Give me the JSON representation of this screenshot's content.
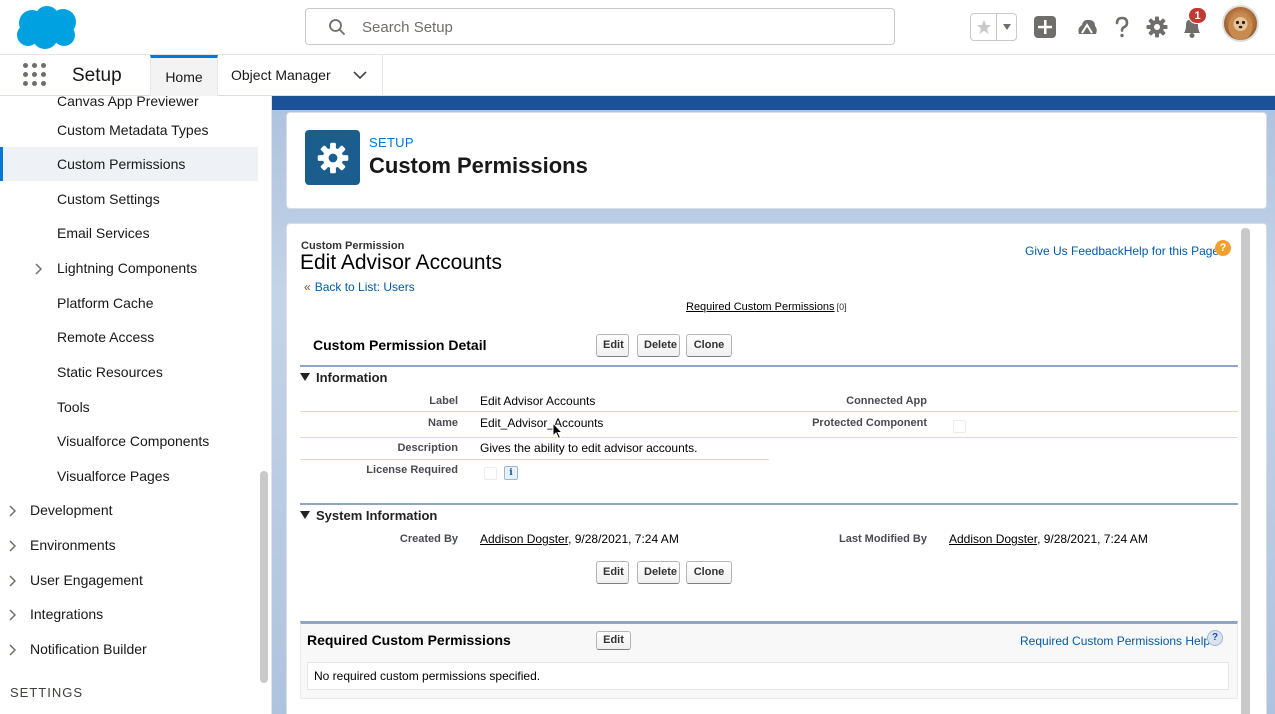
{
  "header": {
    "search_placeholder": "Search Setup",
    "notification_count": "1",
    "brand_color": "#00a1e0"
  },
  "nav": {
    "app_name": "Setup",
    "tabs": [
      {
        "label": "Home",
        "active": true
      },
      {
        "label": "Object Manager",
        "active": false
      }
    ]
  },
  "sidebar": {
    "items": [
      {
        "label": "Canvas App Previewer"
      },
      {
        "label": "Custom Metadata Types"
      },
      {
        "label": "Custom Permissions",
        "active": true
      },
      {
        "label": "Custom Settings"
      },
      {
        "label": "Email Services"
      },
      {
        "label": "Lightning Components"
      },
      {
        "label": "Platform Cache"
      },
      {
        "label": "Remote Access"
      },
      {
        "label": "Static Resources"
      },
      {
        "label": "Tools"
      },
      {
        "label": "Visualforce Components"
      },
      {
        "label": "Visualforce Pages"
      },
      {
        "label": "Development"
      },
      {
        "label": "Environments"
      },
      {
        "label": "User Engagement"
      },
      {
        "label": "Integrations"
      },
      {
        "label": "Notification Builder"
      }
    ],
    "section_heading": "SETTINGS"
  },
  "page_header": {
    "eyebrow": "SETUP",
    "title": "Custom Permissions"
  },
  "detail": {
    "object_type": "Custom Permission",
    "record_name": "Edit Advisor Accounts",
    "back_link_prefix": "«",
    "back_link": "Back to List: Users",
    "feedback_link": "Give Us Feedback",
    "help_link": "Help for this Page",
    "related_link": "Required Custom Permissions",
    "related_count": "[0]",
    "block_title": "Custom Permission Detail",
    "buttons": {
      "edit": "Edit",
      "delete": "Delete",
      "clone": "Clone"
    },
    "info_section": "Information",
    "fields": {
      "label_lbl": "Label",
      "label_val": "Edit Advisor Accounts",
      "name_lbl": "Name",
      "name_val": "Edit_Advisor_Accounts",
      "description_lbl": "Description",
      "description_val": "Gives the ability to edit advisor accounts.",
      "license_lbl": "License Required",
      "connected_app_lbl": "Connected App",
      "protected_lbl": "Protected Component"
    },
    "system_section": "System Information",
    "system": {
      "created_lbl": "Created By",
      "created_user": "Addison Dogster",
      "created_date": ", 9/28/2021, 7:24 AM",
      "modified_lbl": "Last Modified By",
      "modified_user": "Addison Dogster",
      "modified_date": ", 9/28/2021, 7:24 AM"
    }
  },
  "related_list": {
    "title": "Required Custom Permissions",
    "edit_button": "Edit",
    "help_link": "Required Custom Permissions Help",
    "empty_message": "No required custom permissions specified."
  }
}
